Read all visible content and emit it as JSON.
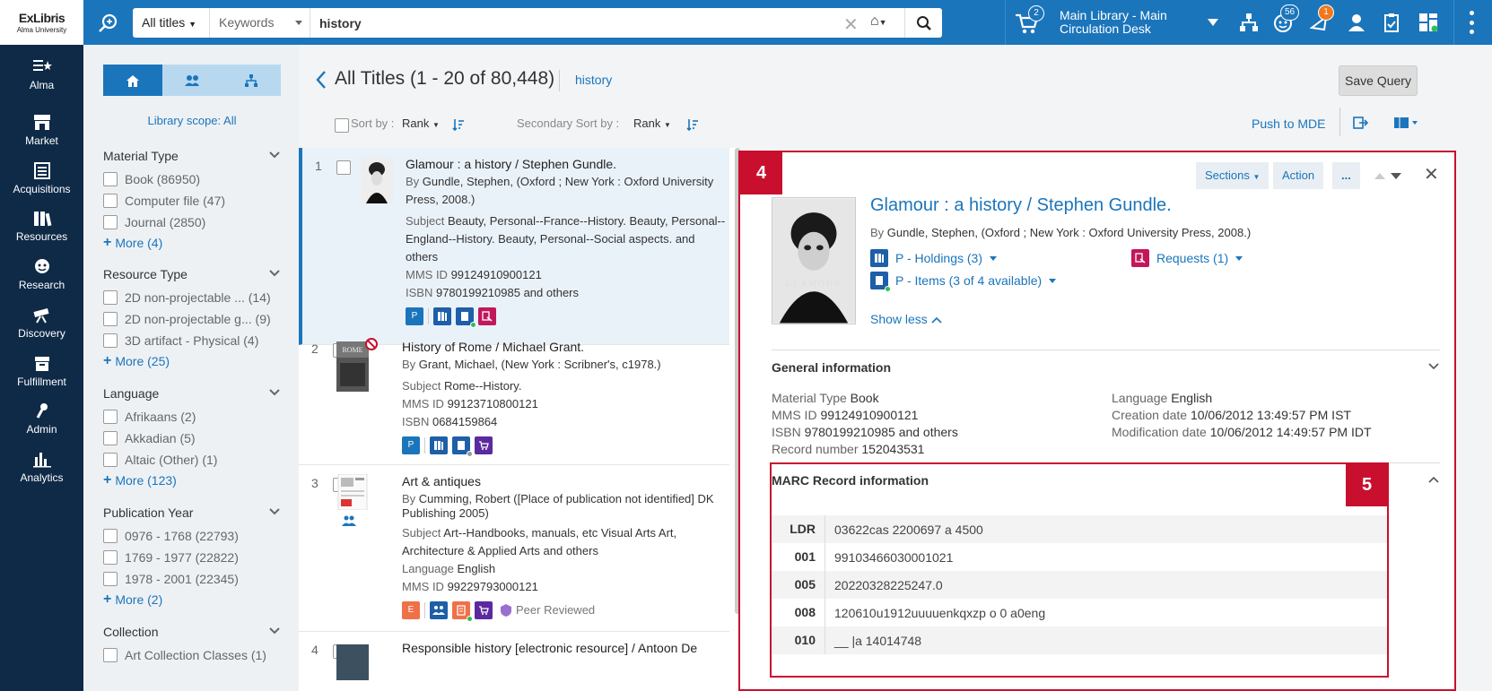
{
  "logo": {
    "line1": "ExLibris",
    "line2": "Alma University"
  },
  "search": {
    "scope": "All titles",
    "field": "Keywords",
    "query": "history"
  },
  "cart_count": "2",
  "desk": "Main Library - Main Circulation Desk",
  "badges": {
    "tasks": "56",
    "alerts": "1"
  },
  "colors": {
    "brand": "#1b75bb",
    "nav_bg": "#0e2a47",
    "highlight": "#c8102e"
  },
  "leftnav": [
    {
      "label": "Alma",
      "icon": "alma-icon"
    },
    {
      "label": "Market",
      "icon": "market-icon"
    },
    {
      "label": "Acquisitions",
      "icon": "acquisitions-icon"
    },
    {
      "label": "Resources",
      "icon": "resources-icon"
    },
    {
      "label": "Research",
      "icon": "research-icon"
    },
    {
      "label": "Discovery",
      "icon": "discovery-icon"
    },
    {
      "label": "Fulfillment",
      "icon": "fulfillment-icon"
    },
    {
      "label": "Admin",
      "icon": "admin-icon"
    },
    {
      "label": "Analytics",
      "icon": "analytics-icon"
    }
  ],
  "facets": {
    "library_scope_label": "Library scope:",
    "library_scope_value": "All",
    "groups": [
      {
        "title": "Material Type",
        "items": [
          "Book (86950)",
          "Computer file (47)",
          "Journal (2850)"
        ],
        "more": "More (4)"
      },
      {
        "title": "Resource Type",
        "items": [
          "2D non-projectable ... (14)",
          "2D non-projectable g... (9)",
          "3D artifact - Physical (4)"
        ],
        "more": "More (25)"
      },
      {
        "title": "Language",
        "items": [
          "Afrikaans (2)",
          "Akkadian (5)",
          "Altaic (Other) (1)"
        ],
        "more": "More (123)"
      },
      {
        "title": "Publication Year",
        "items": [
          "0976 - 1768 (22793)",
          "1769 - 1977 (22822)",
          "1978 - 2001 (22345)"
        ],
        "more": "More (2)"
      },
      {
        "title": "Collection",
        "items": [
          "Art Collection Classes (1)"
        ],
        "more": ""
      }
    ]
  },
  "results_header": {
    "title": "All Titles (1 - 20 of 80,448)",
    "query": "history",
    "save_query": "Save Query",
    "sort_by_label": "Sort by :",
    "sort_by_value": "Rank",
    "secondary_sort_label": "Secondary Sort by :",
    "secondary_sort_value": "Rank",
    "push_to_mde": "Push to MDE"
  },
  "results": [
    {
      "num": "1",
      "title": "Glamour : a history / Stephen Gundle.",
      "by_label": "By",
      "by": "Gundle, Stephen, (Oxford ; New York : Oxford University Press, 2008.)",
      "subject_label": "Subject",
      "subject": "Beauty, Personal--France--History. Beauty, Personal--England--History. Beauty, Personal--Social aspects. and others",
      "mms_label": "MMS ID",
      "mms": "99124910900121",
      "isbn_label": "ISBN",
      "isbn": "9780199210985 and others"
    },
    {
      "num": "2",
      "title": "History of Rome / Michael Grant.",
      "by_label": "By",
      "by": "Grant, Michael, (New York : Scribner's, c1978.)",
      "subject_label": "Subject",
      "subject": "Rome--History.",
      "mms_label": "MMS ID",
      "mms": "99123710800121",
      "isbn_label": "ISBN",
      "isbn": "0684159864"
    },
    {
      "num": "3",
      "title": "Art & antiques",
      "by_label": "By",
      "by": "Cumming, Robert ([Place of publication not identified] DK Publishing 2005)",
      "subject_label": "Subject",
      "subject": "Art--Handbooks, manuals, etc Visual Arts Art, Architecture & Applied Arts and others",
      "lang_label": "Language",
      "lang": "English",
      "mms_label": "MMS ID",
      "mms": "99229793000121",
      "peer": "Peer Reviewed"
    },
    {
      "num": "4",
      "title": "Responsible history [electronic resource] / Antoon De"
    }
  ],
  "detail": {
    "badge4": "4",
    "badge5": "5",
    "sections_btn": "Sections",
    "action_btn": "Action",
    "more_btn": "...",
    "title": "Glamour : a history / Stephen Gundle.",
    "by_label": "By",
    "by": "Gundle, Stephen, (Oxford ; New York : Oxford University Press, 2008.)",
    "holdings": "P - Holdings (3)",
    "items": "P - Items (3 of 4 available)",
    "requests": "Requests (1)",
    "show_less": "Show less",
    "general_title": "General information",
    "general": {
      "material_type_label": "Material Type",
      "material_type": "Book",
      "mms_label": "MMS ID",
      "mms": "99124910900121",
      "isbn_label": "ISBN",
      "isbn": "9780199210985 and others",
      "record_label": "Record number",
      "record": "152043531",
      "language_label": "Language",
      "language": "English",
      "creation_label": "Creation date",
      "creation": "10/06/2012 13:49:57 PM IST",
      "modification_label": "Modification date",
      "modification": "10/06/2012 14:49:57 PM IDT"
    },
    "marc_title": "MARC Record information",
    "marc": [
      {
        "tag": "LDR",
        "value": "03622cas 2200697 a 4500"
      },
      {
        "tag": "001",
        "value": "99103466030001021"
      },
      {
        "tag": "005",
        "value": "20220328225247.0"
      },
      {
        "tag": "008",
        "value": "120610u1912uuuuenkqxzp o 0 a0eng"
      },
      {
        "tag": "010",
        "value": "__ |a 14014748"
      }
    ]
  }
}
